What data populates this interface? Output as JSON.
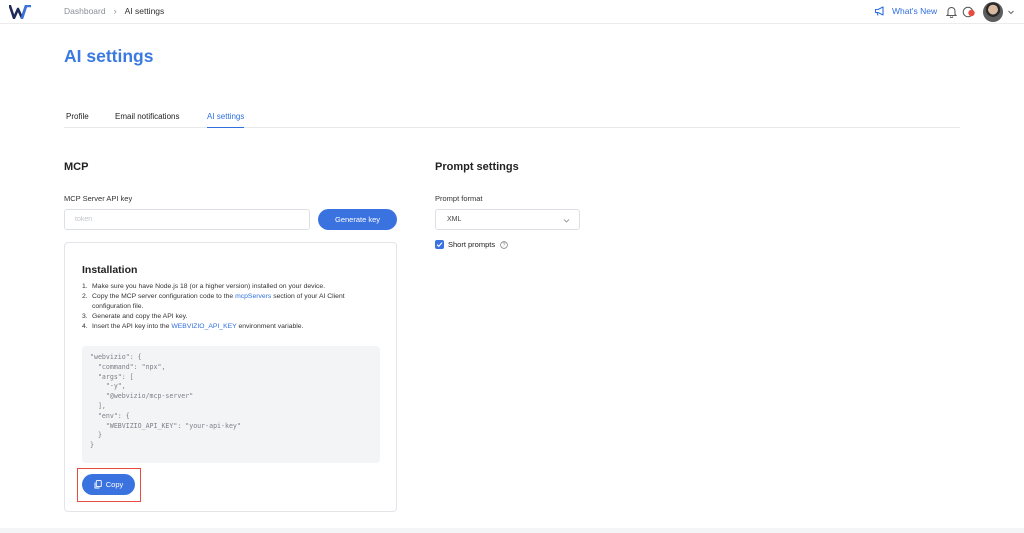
{
  "colors": {
    "accent": "#3a73e0",
    "highlight": "#e74c3c"
  },
  "header": {
    "breadcrumb": {
      "root": "Dashboard",
      "current": "AI settings"
    },
    "whats_new": "What's New",
    "icons": [
      "logo",
      "megaphone-icon",
      "bell-icon",
      "status-icon",
      "avatar",
      "chevron-down-icon"
    ]
  },
  "page": {
    "title": "AI settings"
  },
  "tabs": [
    {
      "label": "Profile",
      "active": false
    },
    {
      "label": "Email notifications",
      "active": false
    },
    {
      "label": "AI settings",
      "active": true
    }
  ],
  "mcp": {
    "title": "MCP",
    "api_key_label": "MCP Server API key",
    "api_key_placeholder": "token",
    "api_key_value": "",
    "generate_label": "Generate key",
    "installation": {
      "title": "Installation",
      "steps": [
        {
          "num": "1.",
          "text": "Make sure you have Node.js 18 (or a higher version) installed on your device."
        },
        {
          "num": "2.",
          "pre": "Copy the MCP server configuration code to the ",
          "link": "mcpServers",
          "post": " section of your AI Client configuration file."
        },
        {
          "num": "3.",
          "text": "Generate and copy the API key."
        },
        {
          "num": "4.",
          "pre": "Insert the API key into the ",
          "link": "WEBVIZIO_API_KEY",
          "post": " environment variable."
        }
      ],
      "code": "\"webvizio\": {\n  \"command\": \"npx\",\n  \"args\": [\n    \"-y\",\n    \"@webvizio/mcp-server\"\n  ],\n  \"env\": {\n    \"WEBVIZIO_API_KEY\": \"your-api-key\"\n  }\n}",
      "copy_label": "Copy"
    }
  },
  "prompt": {
    "title": "Prompt settings",
    "format_label": "Prompt format",
    "format_value": "XML",
    "short_prompts_label": "Short prompts",
    "short_prompts_checked": true
  }
}
